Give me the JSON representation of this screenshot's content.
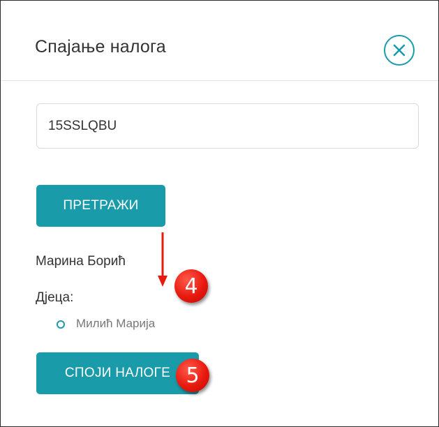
{
  "dialog": {
    "title": "Спајање налога",
    "close_icon": "close-circle-icon"
  },
  "search": {
    "input_value": "15SSLQBU",
    "button_label": "ПРЕТРАЖИ"
  },
  "result": {
    "name": "Марина Борић",
    "children_label": "Дјеца:",
    "children": [
      "Милић Марија"
    ]
  },
  "merge": {
    "button_label": "СПОЈИ НАЛОГЕ"
  },
  "annotations": {
    "step_4": "4",
    "step_5": "5"
  },
  "colors": {
    "accent": "#1a9ba9",
    "annotation": "#e8190f"
  }
}
